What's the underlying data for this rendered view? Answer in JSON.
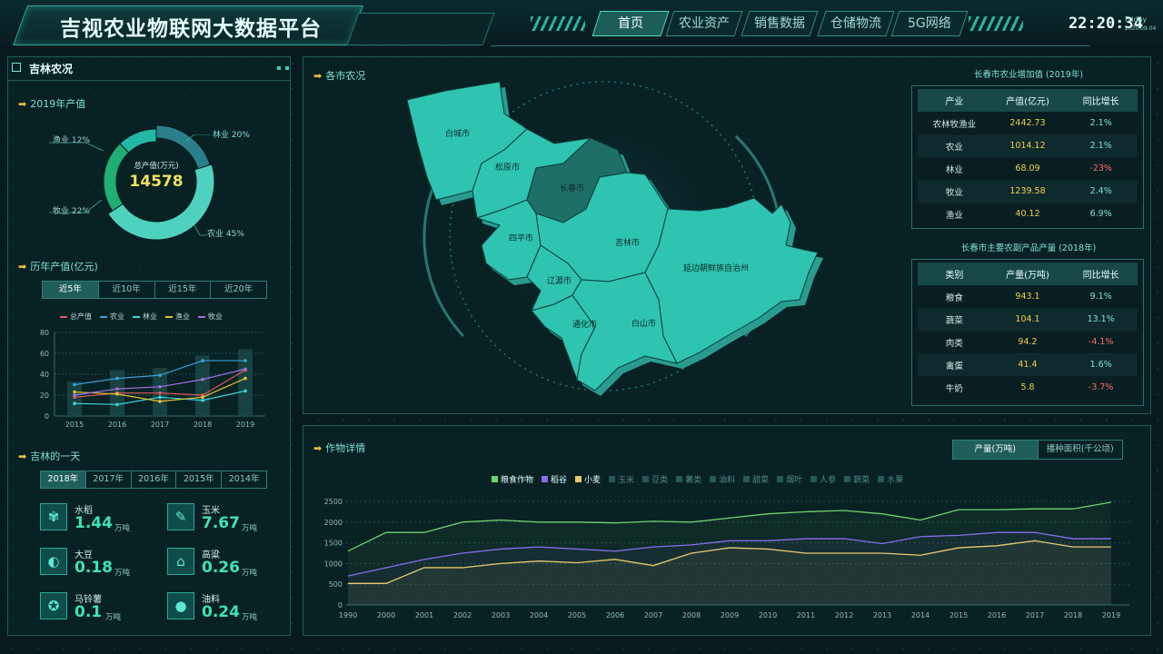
{
  "header": {
    "title": "吉视农业物联网大数据平台",
    "tabs": [
      "首页",
      "农业资产",
      "销售数据",
      "仓储物流",
      "5G网络"
    ],
    "active_tab": 0,
    "time": "22:20:34",
    "weekday": "Friday",
    "date": "2020.09.04"
  },
  "left": {
    "title": "吉林农况",
    "output": {
      "section": "2019年产值",
      "center_label": "总产值(万元)",
      "center_value": "14578",
      "labels": [
        "林业 20%",
        "渔业 12%",
        "牧业 22%",
        "农业 45%"
      ]
    },
    "history": {
      "section": "历年产值(亿元)",
      "ranges": [
        "近5年",
        "近10年",
        "近15年",
        "近20年"
      ],
      "active": 0
    },
    "day": {
      "section": "吉林的一天",
      "years": [
        "2018年",
        "2017年",
        "2016年",
        "2015年",
        "2014年"
      ],
      "active": 0,
      "items": [
        {
          "name": "水稻",
          "value": "1.44",
          "unit": "万吨",
          "icon": "rice-icon"
        },
        {
          "name": "玉米",
          "value": "7.67",
          "unit": "万吨",
          "icon": "corn-icon"
        },
        {
          "name": "大豆",
          "value": "0.18",
          "unit": "万吨",
          "icon": "soybean-icon"
        },
        {
          "name": "高粱",
          "value": "0.26",
          "unit": "万吨",
          "icon": "sorghum-icon"
        },
        {
          "name": "马铃薯",
          "value": "0.1",
          "unit": "万吨",
          "icon": "potato-icon"
        },
        {
          "name": "油料",
          "value": "0.24",
          "unit": "万吨",
          "icon": "oil-drop-icon"
        }
      ]
    }
  },
  "map": {
    "section": "各市农况",
    "cities": [
      "白城市",
      "松原市",
      "长春市",
      "四平市",
      "吉林市",
      "辽源市",
      "延边朝鲜族自治州",
      "通化市",
      "白山市"
    ]
  },
  "table1": {
    "title": "长春市农业增加值 (2019年)",
    "headers": [
      "产业",
      "产值(亿元)",
      "同比增长"
    ],
    "rows": [
      [
        "农林牧渔业",
        "2442.73",
        "2.1%"
      ],
      [
        "农业",
        "1014.12",
        "2.1%"
      ],
      [
        "林业",
        "68.09",
        "-23%"
      ],
      [
        "牧业",
        "1239.58",
        "2.4%"
      ],
      [
        "渔业",
        "40.12",
        "6.9%"
      ]
    ]
  },
  "table2": {
    "title": "长春市主要农副产品产量 (2018年)",
    "headers": [
      "类别",
      "产量(万吨)",
      "同比增长"
    ],
    "rows": [
      [
        "粮食",
        "943.1",
        "9.1%"
      ],
      [
        "蔬菜",
        "104.1",
        "13.1%"
      ],
      [
        "肉类",
        "94.2",
        "-4.1%"
      ],
      [
        "禽蛋",
        "41.4",
        "1.6%"
      ],
      [
        "牛奶",
        "5.8",
        "-3.7%"
      ]
    ]
  },
  "crop": {
    "section": "作物详情",
    "toggle": [
      "产量(万吨)",
      "播种面积(千公顷)"
    ],
    "active": 0,
    "legend": [
      {
        "name": "粮食作物",
        "color": "#6fd36f",
        "on": true
      },
      {
        "name": "稻谷",
        "color": "#8a6cf0",
        "on": true
      },
      {
        "name": "小麦",
        "color": "#e8c870",
        "on": true
      },
      {
        "name": "玉米",
        "color": "#245a57",
        "on": false
      },
      {
        "name": "豆类",
        "color": "#245a57",
        "on": false
      },
      {
        "name": "薯类",
        "color": "#245a57",
        "on": false
      },
      {
        "name": "油料",
        "color": "#245a57",
        "on": false
      },
      {
        "name": "甜菜",
        "color": "#245a57",
        "on": false
      },
      {
        "name": "烟叶",
        "color": "#245a57",
        "on": false
      },
      {
        "name": "人参",
        "color": "#245a57",
        "on": false
      },
      {
        "name": "蔬菜",
        "color": "#245a57",
        "on": false
      },
      {
        "name": "水果",
        "color": "#245a57",
        "on": false
      }
    ]
  },
  "chart_data": [
    {
      "type": "pie",
      "title": "2019年产值",
      "categories": [
        "农业",
        "牧业",
        "渔业",
        "林业"
      ],
      "values": [
        45,
        22,
        12,
        20
      ],
      "colors": [
        "#4fd1bf",
        "#1fae74",
        "#22b8a3",
        "#2b7f8a"
      ]
    },
    {
      "type": "line",
      "title": "历年产值(亿元)",
      "x": [
        "2015",
        "2016",
        "2017",
        "2018",
        "2019"
      ],
      "ylim": [
        0,
        80
      ],
      "yticks": [
        0,
        20,
        40,
        60,
        80
      ],
      "bars": [
        33,
        44,
        46,
        58,
        64
      ],
      "series": [
        {
          "name": "总产值",
          "color": "#e05a5a",
          "values": [
            18,
            22,
            22,
            20,
            44
          ]
        },
        {
          "name": "农业",
          "color": "#3aa0d8",
          "values": [
            30,
            36,
            39,
            53,
            53
          ]
        },
        {
          "name": "林业",
          "color": "#3ed6e0",
          "values": [
            12,
            11,
            18,
            15,
            24
          ]
        },
        {
          "name": "渔业",
          "color": "#e8c030",
          "values": [
            23,
            21,
            14,
            18,
            36
          ]
        },
        {
          "name": "牧业",
          "color": "#a070e0",
          "values": [
            20,
            26,
            28,
            35,
            45
          ]
        }
      ]
    },
    {
      "type": "area",
      "title": "作物详情",
      "x": [
        "1990",
        "2000",
        "2001",
        "2002",
        "2003",
        "2004",
        "2005",
        "2006",
        "2007",
        "2008",
        "2009",
        "2010",
        "2011",
        "2012",
        "2013",
        "2014",
        "2015",
        "2016",
        "2017",
        "2018",
        "2019"
      ],
      "ylim": [
        0,
        2500
      ],
      "yticks": [
        0,
        500,
        1000,
        1500,
        2000,
        2500
      ],
      "series": [
        {
          "name": "粮食作物",
          "color": "#6fd36f",
          "values": [
            1300,
            1750,
            1750,
            2000,
            2050,
            2000,
            2000,
            1980,
            2020,
            2000,
            2100,
            2200,
            2250,
            2280,
            2200,
            2050,
            2300,
            2300,
            2320,
            2320,
            2480
          ]
        },
        {
          "name": "稻谷",
          "color": "#8a6cf0",
          "values": [
            700,
            900,
            1100,
            1250,
            1350,
            1400,
            1350,
            1300,
            1400,
            1450,
            1550,
            1550,
            1600,
            1600,
            1480,
            1650,
            1680,
            1750,
            1750,
            1600,
            1600
          ]
        },
        {
          "name": "小麦",
          "color": "#e8c870",
          "values": [
            520,
            520,
            900,
            900,
            1000,
            1060,
            1020,
            1100,
            950,
            1250,
            1380,
            1350,
            1250,
            1250,
            1250,
            1200,
            1380,
            1430,
            1550,
            1400,
            1400
          ]
        }
      ]
    }
  ]
}
